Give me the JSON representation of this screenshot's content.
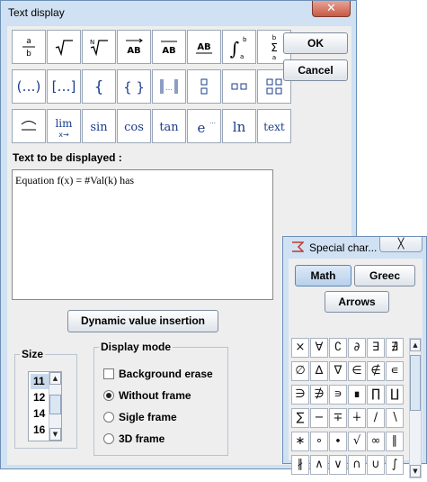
{
  "dialog": {
    "title": "Text display",
    "close_glyph": "✕",
    "ok_label": "OK",
    "cancel_label": "Cancel",
    "toolbar_row1": [
      "fraction-icon",
      "square-root-icon",
      "nth-root-icon",
      "vector-icon",
      "overline-icon",
      "underline-icon",
      "integral-icon",
      "sum-icon"
    ],
    "toolbar_row2": [
      "parentheses-icon",
      "brackets-icon",
      "left-brace-icon",
      "braces-icon",
      "norm-icon",
      "column-matrix-icon",
      "row-matrix-icon",
      "matrix-icon"
    ],
    "toolbar_row3": [
      {
        "name": "hat-icon",
        "text": ""
      },
      {
        "name": "limit-icon",
        "text": "lim"
      },
      {
        "name": "sin-icon",
        "text": "sin"
      },
      {
        "name": "cos-icon",
        "text": "cos"
      },
      {
        "name": "tan-icon",
        "text": "tan"
      },
      {
        "name": "exponential-icon",
        "text": "e"
      },
      {
        "name": "ln-icon",
        "text": "ln"
      },
      {
        "name": "text-icon",
        "text": "text"
      }
    ],
    "text_label": "Text to be displayed :",
    "text_value": "Equation f(x) = #Val(k) has",
    "dynamic_button": "Dynamic value insertion",
    "size": {
      "title": "Size",
      "items": [
        "11",
        "12",
        "14",
        "16"
      ],
      "selected": "11"
    },
    "display_mode": {
      "title": "Display mode",
      "background_erase": "Background erase",
      "background_erase_checked": false,
      "options": [
        "Without frame",
        "Sigle frame",
        "3D frame"
      ],
      "selected": "Without frame"
    }
  },
  "special_chars": {
    "title": "Special char...",
    "close_glyph": "╳",
    "tabs": [
      "Math",
      "Greec",
      "Arrows"
    ],
    "selected_tab": "Math",
    "chars": [
      [
        "×",
        "∀",
        "∁",
        "∂",
        "∃",
        "∄"
      ],
      [
        "∅",
        "∆",
        "∇",
        "∈",
        "∉",
        "∊"
      ],
      [
        "∋",
        "∌",
        "∍",
        "∎",
        "∏",
        "∐"
      ],
      [
        "∑",
        "−",
        "∓",
        "∔",
        "∕",
        "∖"
      ],
      [
        "∗",
        "∘",
        "∙",
        "√",
        "∞",
        "∥"
      ],
      [
        "∦",
        "∧",
        "∨",
        "∩",
        "∪",
        "∫"
      ]
    ]
  },
  "colors": {
    "title_bar": "#cfe1f3",
    "close_red": "#c75a45",
    "selection": "#c9d9ec"
  }
}
